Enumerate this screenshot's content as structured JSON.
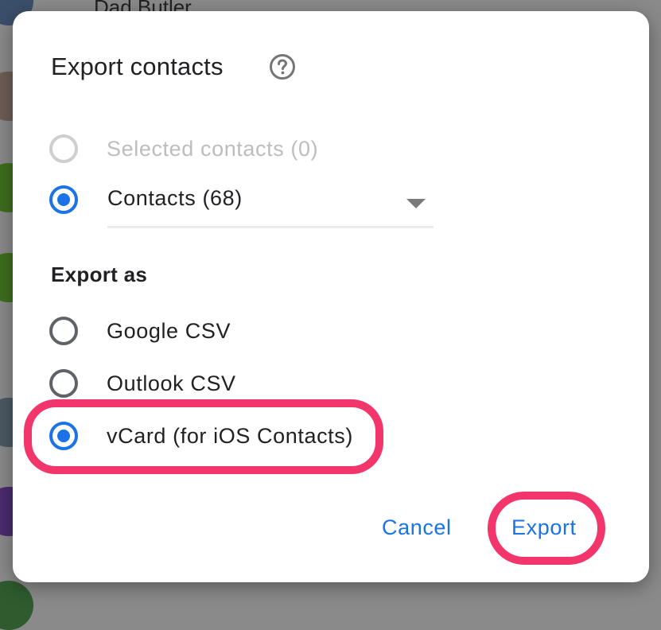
{
  "background": {
    "contacts": [
      "Dad Butler"
    ]
  },
  "dialog": {
    "title": "Export contacts",
    "help_icon": "help-circle-icon",
    "scope_options": [
      {
        "label": "Selected contacts (0)",
        "state": "disabled"
      },
      {
        "label": "Contacts (68)",
        "state": "checked"
      }
    ],
    "export_as_heading": "Export as",
    "format_options": [
      {
        "label": "Google CSV",
        "state": "unchecked"
      },
      {
        "label": "Outlook CSV",
        "state": "unchecked"
      },
      {
        "label": "vCard (for iOS Contacts)",
        "state": "checked"
      }
    ],
    "cancel_label": "Cancel",
    "export_label": "Export"
  },
  "colors": {
    "accent": "#1a73e8",
    "highlight": "#f2366c",
    "text": "#202124"
  }
}
